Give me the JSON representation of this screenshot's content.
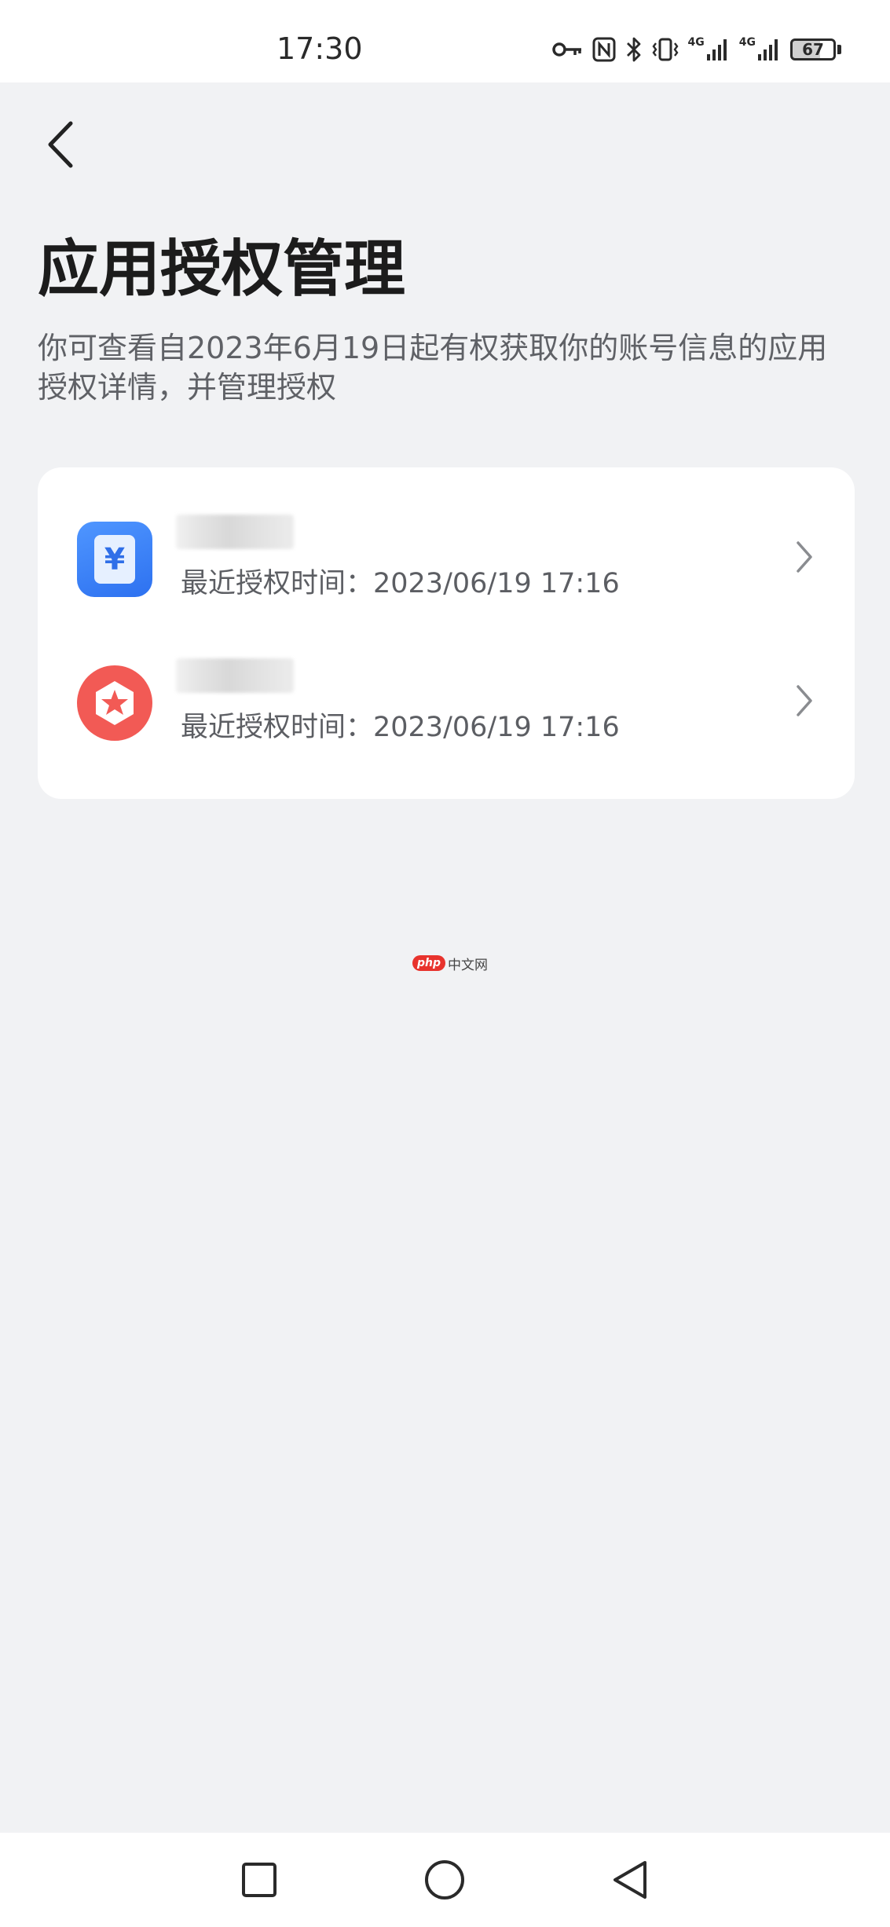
{
  "status_bar": {
    "time": "17:30",
    "network_label": "4G",
    "battery_level": 67,
    "battery_text": "67",
    "icons": [
      "key-icon",
      "nfc-icon",
      "bluetooth-icon",
      "vibrate-icon",
      "signal-icon",
      "signal-icon",
      "battery-icon"
    ]
  },
  "header": {
    "title": "应用授权管理",
    "description": "你可查看自2023年6月19日起有权获取你的账号信息的应用授权详情，并管理授权"
  },
  "apps": [
    {
      "icon": "wallet-icon",
      "icon_color": "#2d71f0",
      "icon_glyph": "¥",
      "name": "",
      "time_label": "最近授权时间：2023/06/19 17:16"
    },
    {
      "icon": "star-badge-icon",
      "icon_color": "#f25a55",
      "name": "",
      "time_label": "最近授权时间：2023/06/19 17:16"
    }
  ],
  "watermark": {
    "badge": "php",
    "text": "中文网"
  },
  "colors": {
    "background": "#f1f2f4",
    "card": "#ffffff",
    "title": "#1c1c1c",
    "secondary_text": "#5f6166"
  }
}
